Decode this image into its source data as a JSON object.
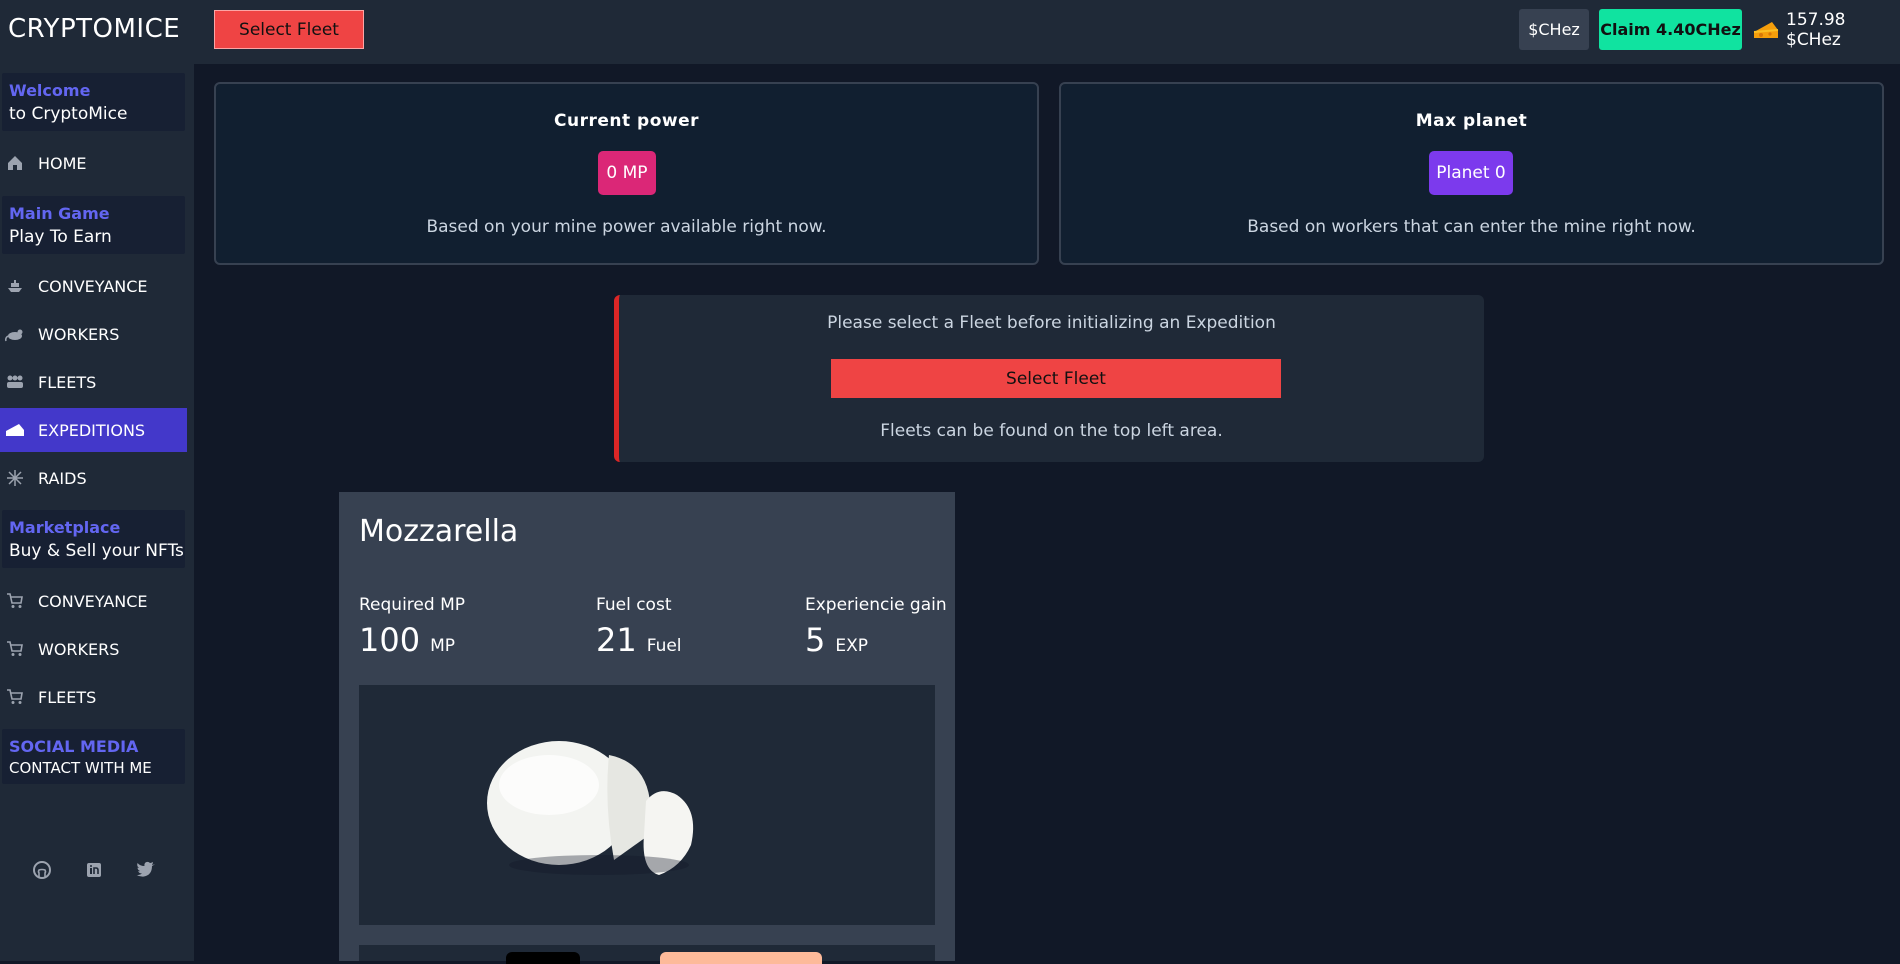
{
  "header": {
    "logo": "CRYPTOMICE",
    "select_fleet": "Select Fleet",
    "token_button": "$CHez",
    "claim_button": "Claim 4.40CHez",
    "balance": "157.98 $CHez"
  },
  "sidebar": {
    "welcome": {
      "title": "Welcome",
      "subtitle": "to CryptoMice"
    },
    "home": "HOME",
    "main_game": {
      "title": "Main Game",
      "subtitle": "Play To Earn"
    },
    "game_items": [
      "CONVEYANCE",
      "WORKERS",
      "FLEETS",
      "EXPEDITIONS",
      "RAIDS"
    ],
    "marketplace": {
      "title": "Marketplace",
      "subtitle": "Buy & Sell your NFTs"
    },
    "market_items": [
      "CONVEYANCE",
      "WORKERS",
      "FLEETS"
    ],
    "social": {
      "title": "SOCIAL MEDIA",
      "subtitle": "CONTACT WITH ME"
    }
  },
  "cards": {
    "power": {
      "title": "Current power",
      "value": "0 MP",
      "description": "Based on your mine power available right now."
    },
    "planet": {
      "title": "Max planet",
      "value": "Planet 0",
      "description": "Based on workers that can enter the mine right now."
    }
  },
  "notice": {
    "message": "Please select a Fleet before initializing an Expedition",
    "button": "Select Fleet",
    "hint": "Fleets can be found on the top left area."
  },
  "expedition": {
    "name": "Mozzarella",
    "stats": [
      {
        "label": "Required MP",
        "value": "100",
        "unit": "MP"
      },
      {
        "label": "Fuel cost",
        "value": "21",
        "unit": "Fuel"
      },
      {
        "label": "Experiencie gain",
        "value": "5",
        "unit": "EXP"
      }
    ]
  },
  "colors": {
    "accent": "#6366f1",
    "active_nav": "#4338ca",
    "danger": "#ef4444",
    "claim": "#10e3a0",
    "power_pill": "#db2777",
    "planet_pill": "#7c3aed"
  }
}
